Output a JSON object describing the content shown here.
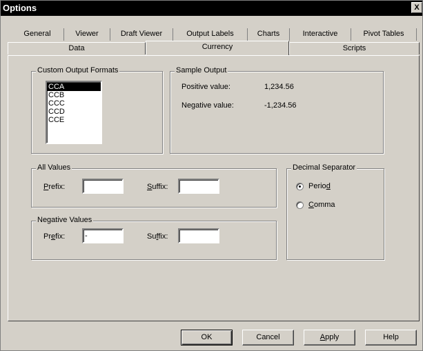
{
  "window": {
    "title": "Options",
    "close_glyph": "X"
  },
  "tabs_row1": [
    "General",
    "Viewer",
    "Draft Viewer",
    "Output Labels",
    "Charts",
    "Interactive",
    "Pivot Tables"
  ],
  "tabs_row2": [
    "Data",
    "Currency",
    "Scripts"
  ],
  "custom_formats": {
    "legend": "Custom Output Formats",
    "items": [
      "CCA",
      "CCB",
      "CCC",
      "CCD",
      "CCE"
    ],
    "selected": "CCA"
  },
  "sample_output": {
    "legend": "Sample Output",
    "positive_label": "Positive value:",
    "positive_value": "1,234.56",
    "negative_label": "Negative value:",
    "negative_value": "-1,234.56"
  },
  "all_values": {
    "legend": "All Values",
    "prefix_label_u": "P",
    "prefix_label_rest": "refix:",
    "prefix_value": "",
    "suffix_label_u": "S",
    "suffix_label_rest": "uffix:",
    "suffix_value": ""
  },
  "negative_values": {
    "legend": "Negative Values",
    "prefix_label_a": "Pr",
    "prefix_label_u": "e",
    "prefix_label_b": "fix:",
    "prefix_value": "-",
    "suffix_label_a": "Su",
    "suffix_label_u": "f",
    "suffix_label_b": "fix:",
    "suffix_value": ""
  },
  "decimal_separator": {
    "legend": "Decimal Separator",
    "period_a": "Perio",
    "period_u": "d",
    "comma_u": "C",
    "comma_b": "omma",
    "selected": "Period"
  },
  "buttons": {
    "ok": "OK",
    "cancel": "Cancel",
    "apply_u": "A",
    "apply_rest": "pply",
    "help": "Help"
  }
}
